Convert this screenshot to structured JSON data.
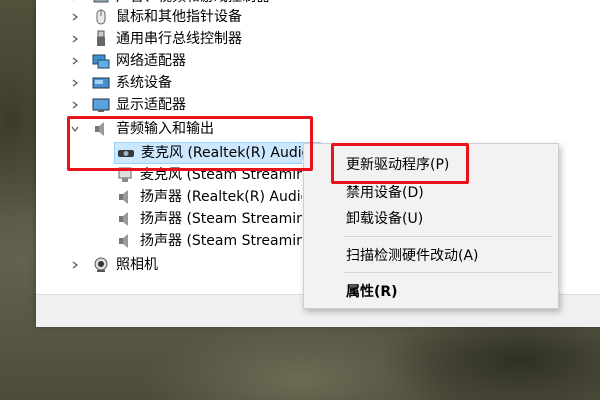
{
  "tree": {
    "rows": [
      {
        "label": "声音、视频和游戏控制器",
        "expanded": false,
        "icon": "sound-video-icon"
      },
      {
        "label": "鼠标和其他指针设备",
        "expanded": false,
        "icon": "mouse-icon"
      },
      {
        "label": "通用串行总线控制器",
        "expanded": false,
        "icon": "usb-icon"
      },
      {
        "label": "网络适配器",
        "expanded": false,
        "icon": "network-adapter-icon"
      },
      {
        "label": "系统设备",
        "expanded": false,
        "icon": "system-device-icon"
      },
      {
        "label": "显示适配器",
        "expanded": false,
        "icon": "display-adapter-icon"
      },
      {
        "label": "音频输入和输出",
        "expanded": true,
        "icon": "speaker-icon"
      },
      {
        "label": "麦克风 (Realtek(R) Audio)",
        "selected": true,
        "icon": "microphone-icon"
      },
      {
        "label": "麦克风 (Steam Streaming Microphone)",
        "icon": "microphone-icon"
      },
      {
        "label": "扬声器 (Realtek(R) Audio)",
        "icon": "speaker-icon"
      },
      {
        "label": "扬声器 (Steam Streaming Microphone)",
        "icon": "speaker-icon"
      },
      {
        "label": "扬声器 (Steam Streaming Speakers)",
        "icon": "speaker-icon"
      },
      {
        "label": "照相机",
        "expanded": false,
        "icon": "camera-icon"
      }
    ]
  },
  "context_menu": {
    "items": [
      {
        "label": "更新驱动程序(P)"
      },
      {
        "label": "禁用设备(D)"
      },
      {
        "label": "卸载设备(U)"
      },
      {
        "label": "扫描检测硬件改动(A)"
      },
      {
        "label": "属性(R)",
        "bold": true
      }
    ]
  },
  "colors": {
    "highlight": "#e8121b",
    "selection_bg": "#cce8ff",
    "selection_border": "#99d1ff"
  }
}
